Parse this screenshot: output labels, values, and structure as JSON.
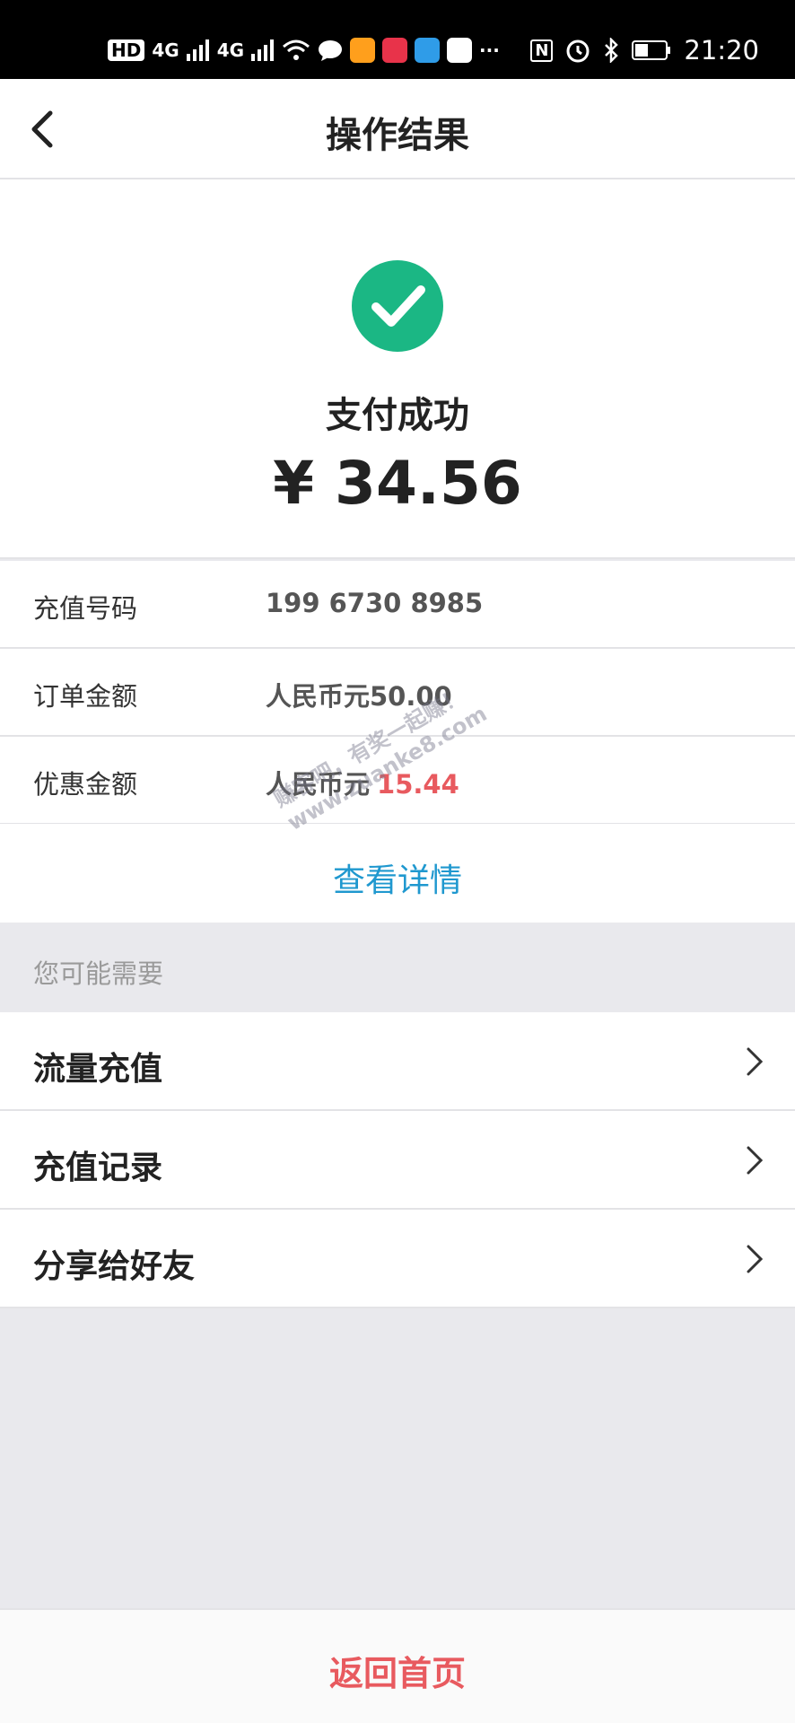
{
  "status_bar": {
    "hd_label": "HD",
    "network_1": "4G",
    "network_2": "4G",
    "more": "···",
    "nfc_label": "N",
    "time": "21:20",
    "icons": [
      "signal-icon",
      "wifi-icon",
      "chat-icon",
      "video-app-icon",
      "shopping-app-icon",
      "map-app-icon",
      "baidu-app-icon",
      "nfc-icon",
      "alarm-icon",
      "bluetooth-icon",
      "battery-icon"
    ]
  },
  "nav": {
    "title": "操作结果",
    "back_icon": "chevron-left-icon"
  },
  "result": {
    "status_text": "支付成功",
    "amount_text": "¥ 34.56",
    "success_color": "#1bb784"
  },
  "details": [
    {
      "label": "充值号码",
      "value": "199 6730 8985"
    },
    {
      "label": "订单金额",
      "value": "人民币元50.00"
    },
    {
      "label": "优惠金额",
      "value_prefix": "人民币元",
      "value_highlight": "15.44"
    }
  ],
  "view_details": "查看详情",
  "section_header": "您可能需要",
  "menu_items": [
    {
      "label": "流量充值"
    },
    {
      "label": "充值记录"
    },
    {
      "label": "分享给好友"
    }
  ],
  "bottom": {
    "home_label": "返回首页"
  },
  "watermark": {
    "line1": "赚客吧，有奖一起赚！",
    "line2": "www.zuanke8.com"
  },
  "colors": {
    "accent_red": "#e85a5f",
    "link_blue": "#1f98cf",
    "success_green": "#1bb784"
  }
}
